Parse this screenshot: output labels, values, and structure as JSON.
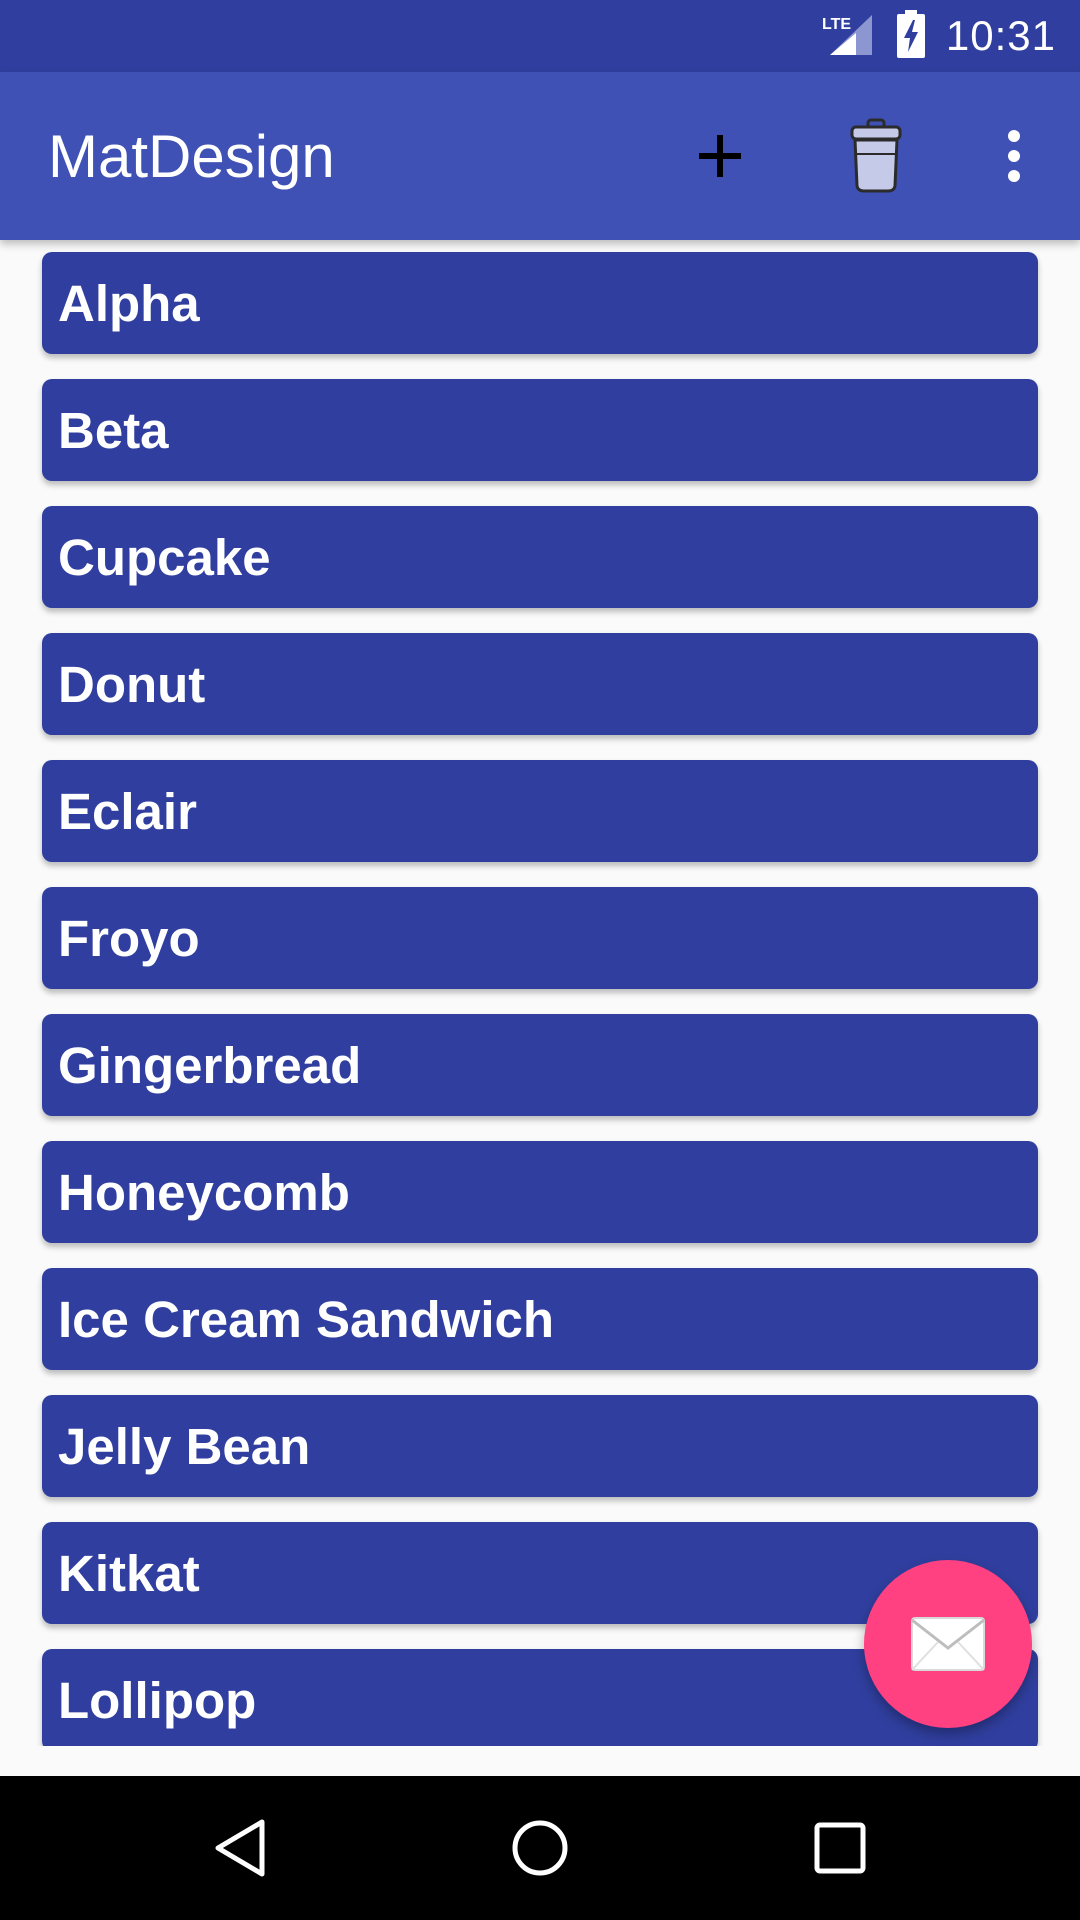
{
  "status_bar": {
    "network": "LTE",
    "time": "10:31"
  },
  "app_bar": {
    "title": "MatDesign",
    "actions": [
      {
        "name": "add",
        "icon": "plus-icon"
      },
      {
        "name": "delete",
        "icon": "trash-icon"
      },
      {
        "name": "more",
        "icon": "overflow-menu-icon"
      }
    ]
  },
  "list": {
    "items": [
      "Alpha",
      "Beta",
      "Cupcake",
      "Donut",
      "Eclair",
      "Froyo",
      "Gingerbread",
      "Honeycomb",
      "Ice Cream Sandwich",
      "Jelly Bean",
      "Kitkat",
      "Lollipop"
    ]
  },
  "fab": {
    "icon": "envelope-icon"
  },
  "nav_bar": {
    "buttons": [
      "back-icon",
      "home-icon",
      "recents-icon"
    ]
  },
  "colors": {
    "primary_dark": "#303f9f",
    "primary": "#3f51b5",
    "accent": "#ff4081",
    "card": "#303f9f",
    "background": "#fafafa"
  }
}
